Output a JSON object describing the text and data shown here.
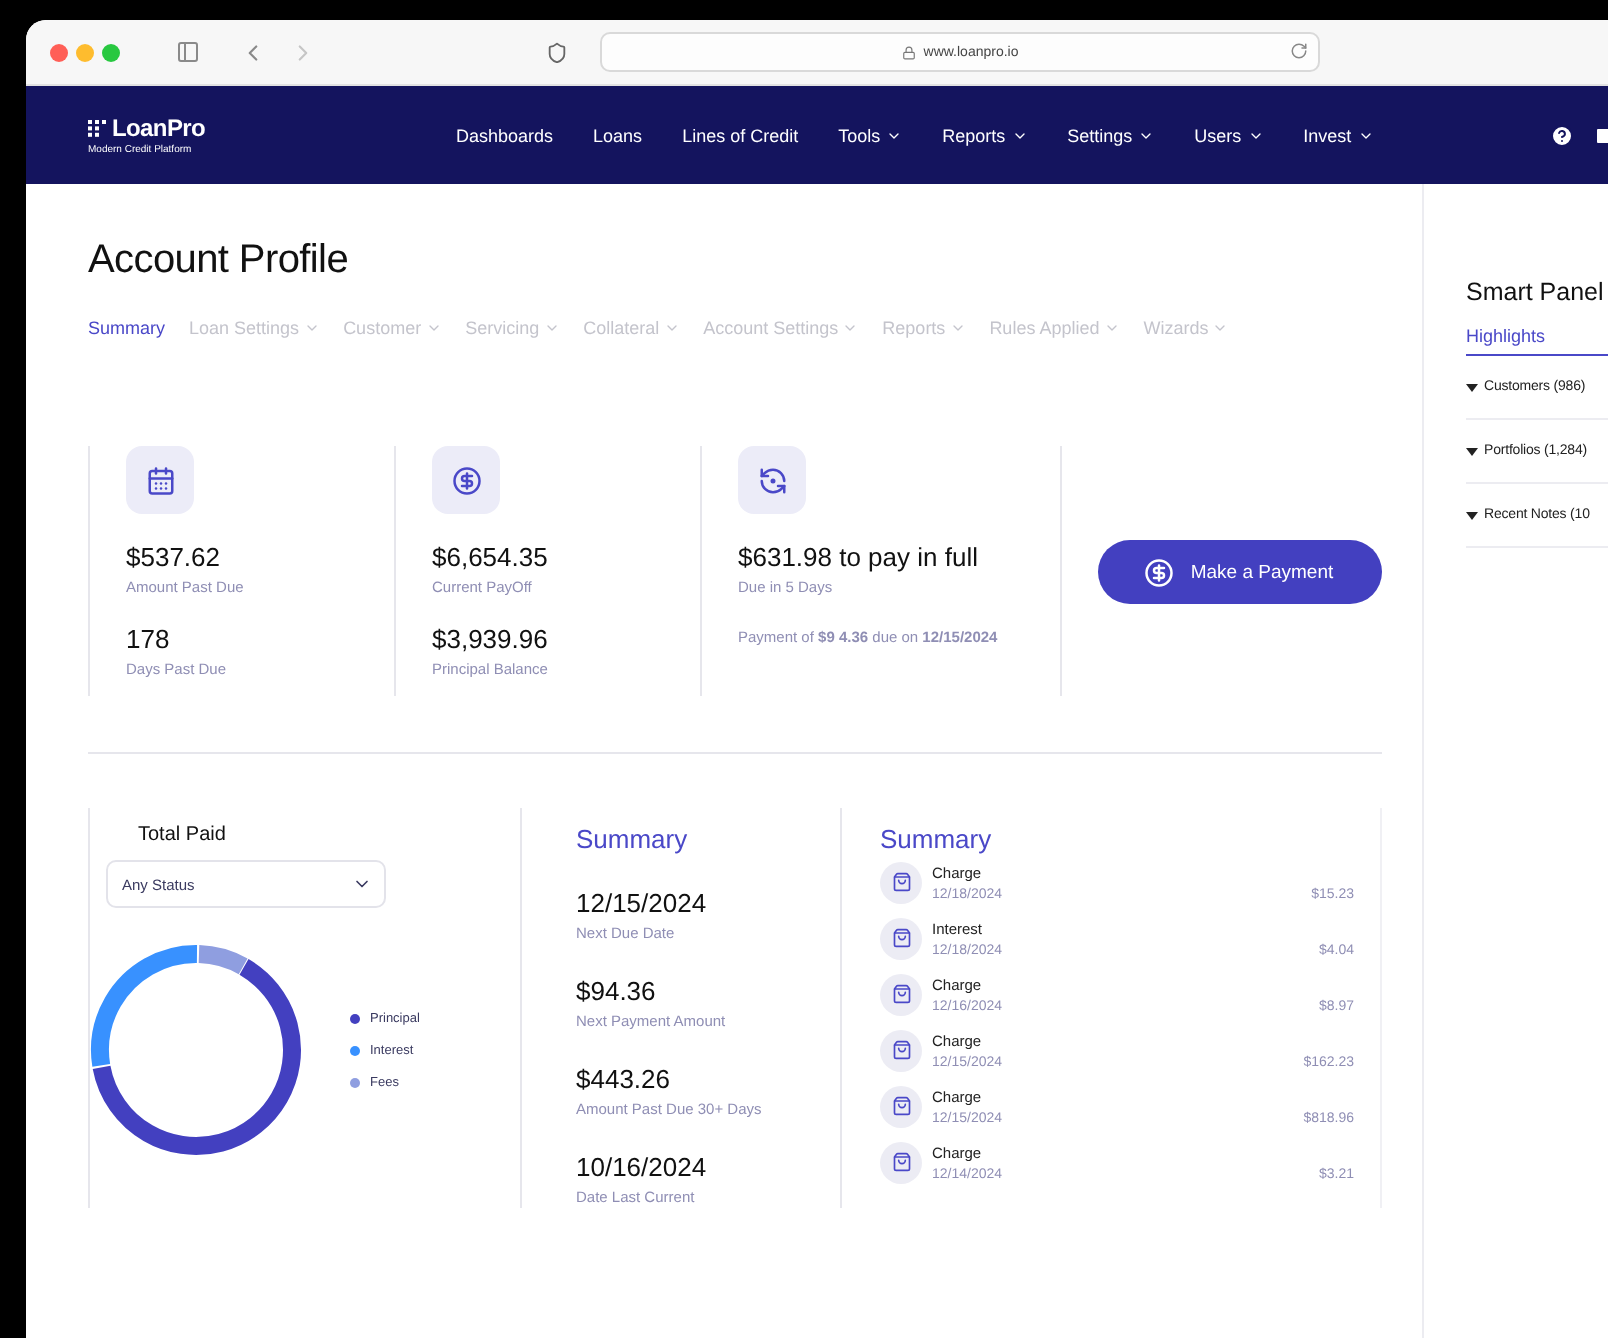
{
  "browser": {
    "url": "www.loanpro.io"
  },
  "nav": {
    "logo": {
      "name": "LoanPro",
      "tagline": "Modern Credit Platform"
    },
    "items": [
      {
        "label": "Dashboards",
        "dropdown": false
      },
      {
        "label": "Loans",
        "dropdown": false
      },
      {
        "label": "Lines of Credit",
        "dropdown": false
      },
      {
        "label": "Tools",
        "dropdown": true
      },
      {
        "label": "Reports",
        "dropdown": true
      },
      {
        "label": "Settings",
        "dropdown": true
      },
      {
        "label": "Users",
        "dropdown": true
      },
      {
        "label": "Invest",
        "dropdown": true
      }
    ]
  },
  "page": {
    "title": "Account Profile",
    "tabs": [
      {
        "label": "Summary",
        "selected": true,
        "dropdown": false
      },
      {
        "label": "Loan Settings",
        "selected": false,
        "dropdown": true
      },
      {
        "label": "Customer",
        "selected": false,
        "dropdown": true
      },
      {
        "label": "Servicing",
        "selected": false,
        "dropdown": true
      },
      {
        "label": "Collateral",
        "selected": false,
        "dropdown": true
      },
      {
        "label": "Account Settings",
        "selected": false,
        "dropdown": true
      },
      {
        "label": "Reports",
        "selected": false,
        "dropdown": true
      },
      {
        "label": "Rules Applied",
        "selected": false,
        "dropdown": true
      },
      {
        "label": "Wizards",
        "selected": false,
        "dropdown": true
      }
    ]
  },
  "stats": [
    {
      "kind": "pair",
      "entries": [
        {
          "value": "$537.62",
          "label": "Amount Past Due"
        },
        {
          "value": "178",
          "label": "Days Past Due"
        }
      ]
    },
    {
      "kind": "pair",
      "entries": [
        {
          "value": "$6,654.35",
          "label": "Current PayOff"
        },
        {
          "value": "$3,939.96",
          "label": "Principal Balance"
        }
      ]
    },
    {
      "kind": "payoff",
      "entries": [
        {
          "value": "$631.98 to pay in full",
          "label": "Due in 5 Days"
        }
      ],
      "note": "Payment of **$9 4.36** due on **12/15/2024**"
    }
  ],
  "payment_button": "Make a Payment",
  "total_paid": {
    "title": "Total Paid",
    "filter": {
      "value": "Any Status"
    },
    "legend": [
      {
        "label": "Principal",
        "color": "#4340c0"
      },
      {
        "label": "Interest",
        "color": "#3891ff"
      },
      {
        "label": "Fees",
        "color": "#8f9ee0"
      }
    ]
  },
  "summary": {
    "title": "Summary",
    "items": [
      {
        "value": "12/15/2024",
        "label": "Next Due Date"
      },
      {
        "value": "$94.36",
        "label": "Next Payment Amount"
      },
      {
        "value": "$443.26",
        "label": "Amount Past Due 30+ Days"
      },
      {
        "value": "10/16/2024",
        "label": "Date Last Current"
      }
    ]
  },
  "activity": {
    "title": "Summary",
    "rows": [
      {
        "type": "Charge",
        "date": "12/18/2024",
        "amount": "$15.23"
      },
      {
        "type": "Interest",
        "date": "12/18/2024",
        "amount": "$4.04"
      },
      {
        "type": "Charge",
        "date": "12/16/2024",
        "amount": "$8.97"
      },
      {
        "type": "Charge",
        "date": "12/15/2024",
        "amount": "$162.23"
      },
      {
        "type": "Charge",
        "date": "12/15/2024",
        "amount": "$818.96"
      },
      {
        "type": "Charge",
        "date": "12/14/2024",
        "amount": "$3.21"
      }
    ]
  },
  "smart_panel": {
    "title": "Smart Panel",
    "tabs": [
      {
        "label": "Highlights",
        "selected": true
      }
    ],
    "sections": [
      {
        "label": "Customers (986)"
      },
      {
        "label": "Portfolios (1,284)"
      },
      {
        "label": "Recent Notes (10"
      }
    ]
  }
}
